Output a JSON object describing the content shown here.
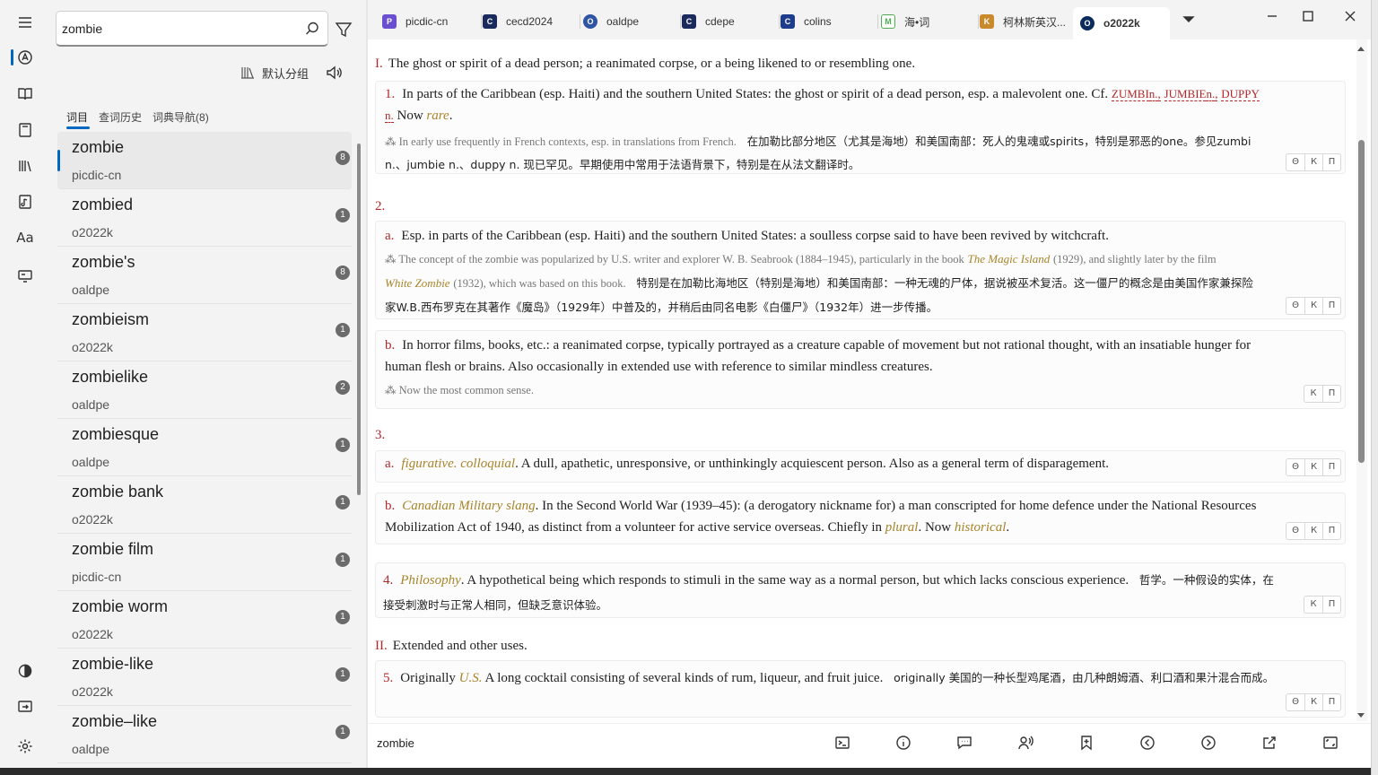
{
  "search": {
    "value": "zombie"
  },
  "toolbar": {
    "group_label": "默认分组"
  },
  "left_tabs": [
    {
      "label": "词目"
    },
    {
      "label": "查词历史"
    },
    {
      "label": "词典导航(8)"
    }
  ],
  "word_list": [
    {
      "word": "zombie",
      "source": "picdic-cn",
      "count": "8"
    },
    {
      "word": "zombied",
      "source": "o2022k",
      "count": "1"
    },
    {
      "word": "zombie's",
      "source": "oaldpe",
      "count": "8"
    },
    {
      "word": "zombieism",
      "source": "o2022k",
      "count": "1"
    },
    {
      "word": "zombielike",
      "source": "oaldpe",
      "count": "2"
    },
    {
      "word": "zombiesque",
      "source": "oaldpe",
      "count": "1"
    },
    {
      "word": "zombie bank",
      "source": "o2022k",
      "count": "1"
    },
    {
      "word": "zombie film",
      "source": "picdic-cn",
      "count": "1"
    },
    {
      "word": "zombie worm",
      "source": "o2022k",
      "count": "1"
    },
    {
      "word": "zombie-like",
      "source": "o2022k",
      "count": "1"
    },
    {
      "word": "zombie–like",
      "source": "oaldpe",
      "count": "1"
    }
  ],
  "rail": {
    "font_label": "Aa"
  },
  "dict_tabs": [
    {
      "label": "picdic-cn",
      "icon": "picdic-icon",
      "color": "#6a4fd1"
    },
    {
      "label": "cecd2024",
      "icon": "cecd-icon",
      "color": "#1b2a5c"
    },
    {
      "label": "oaldpe",
      "icon": "oaldpe-icon",
      "color": "#2f55a4"
    },
    {
      "label": "cdepe",
      "icon": "cdepe-icon",
      "color": "#1b2a5c"
    },
    {
      "label": "colins",
      "icon": "collins-icon",
      "color": "#1e3c8c"
    },
    {
      "label": "海•词",
      "icon": "haici-icon",
      "color": "#4caf50"
    },
    {
      "label": "柯林斯英汉...",
      "icon": "collins-cn-icon",
      "color": "#c88a2a"
    },
    {
      "label": "o2022k",
      "icon": "o2022k-icon",
      "color": "#0a2b5c"
    }
  ],
  "entry": {
    "sense_I": {
      "num": "I.",
      "text": "The ghost or spirit of a dead person; a reanimated corpse, or a being likened to or resembling one."
    },
    "s1": {
      "num": "1.",
      "text": "In parts of the Caribbean (esp. Haiti) and the southern United States: the ghost or spirit of a dead person, esp. a malevolent one. Cf.",
      "xrefs": [
        "ZUMBI",
        "n.",
        ",",
        "JUMBIE",
        "n.",
        ",",
        "DUPPY"
      ],
      "xref_n": "n.",
      "now": "Now",
      "rare": "rare",
      "note": "⁂ In early use frequently in French contexts, esp. in translations from French.",
      "cn1": "在加勒比部分地区（尤其是海地）和美国南部：死人的鬼魂或spirits，特别是邪恶的one。参见zumbi",
      "cn2": "n.、jumbie n.、duppy n. 现已罕见。早期使用中常用于法语背景下，特别是在从法文翻译时。"
    },
    "s2": {
      "num": "2."
    },
    "s2a": {
      "num": "a.",
      "text": "Esp. in parts of the Caribbean (esp. Haiti) and the southern United States: a soulless corpse said to have been revived by witchcraft.",
      "note_a": "⁂ The concept of the zombie was popularized by U.S. writer and explorer W. B. Seabrook (1884–1945), particularly in the book",
      "book1": "The Magic Island",
      "note_b": "(1929), and slightly later by the film",
      "book2": "White Zombie",
      "note_c": "(1932), which was based on this book.",
      "cn1": "特别是在加勒比海地区（特别是海地）和美国南部：一种无魂的尸体，据说被巫术复活。这一僵尸的概念是由美国作家兼探险",
      "cn2": "家W.B.西布罗克在其著作《魔岛》（1929年）中普及的，并稍后由同名电影《白僵尸》（1932年）进一步传播。"
    },
    "s2b": {
      "num": "b.",
      "text1": "In horror films, books, etc.: a reanimated corpse, typically portrayed as a creature capable of movement but not rational thought, with an insatiable hunger for",
      "text2": "human flesh or brains. Also occasionally in extended use with reference to similar mindless creatures.",
      "note": "⁂ Now the most common sense."
    },
    "s3": {
      "num": "3."
    },
    "s3a": {
      "num": "a.",
      "label": "figurative. colloquial",
      "text": ". A dull, apathetic, unresponsive, or unthinkingly acquiescent person. Also as a general term of disparagement."
    },
    "s3b": {
      "num": "b.",
      "label": "Canadian Military slang",
      "text1": ". In the Second World War (1939–45): (a derogatory nickname for) a man conscripted for home defence under the National Resources",
      "text2": "Mobilization Act of 1940, as distinct from a volunteer for active service overseas. Chiefly in",
      "plural": "plural",
      "now": ". Now",
      "historical": "historical",
      "end": "."
    },
    "s4": {
      "num": "4.",
      "label": "Philosophy",
      "text": ". A hypothetical being which responds to stimuli in the same way as a normal person, but which lacks conscious experience.",
      "cn1": "哲学。一种假设的实体，在",
      "cn2": "接受刺激时与正常人相同，但缺乏意识体验。"
    },
    "sense_II": {
      "num": "II.",
      "text": "Extended and other uses."
    },
    "s5": {
      "num": "5.",
      "pre": "Originally",
      "label": "U.S.",
      "text": "A long cocktail consisting of several kinds of rum, liqueur, and fruit juice.",
      "cn": "originally 美国的一种长型鸡尾酒，由几种朗姆酒、利口酒和果汁混合而成。"
    },
    "actions": {
      "collapse": "Θ",
      "k": "К",
      "p": "П"
    }
  },
  "footer": {
    "word": "zombie"
  }
}
